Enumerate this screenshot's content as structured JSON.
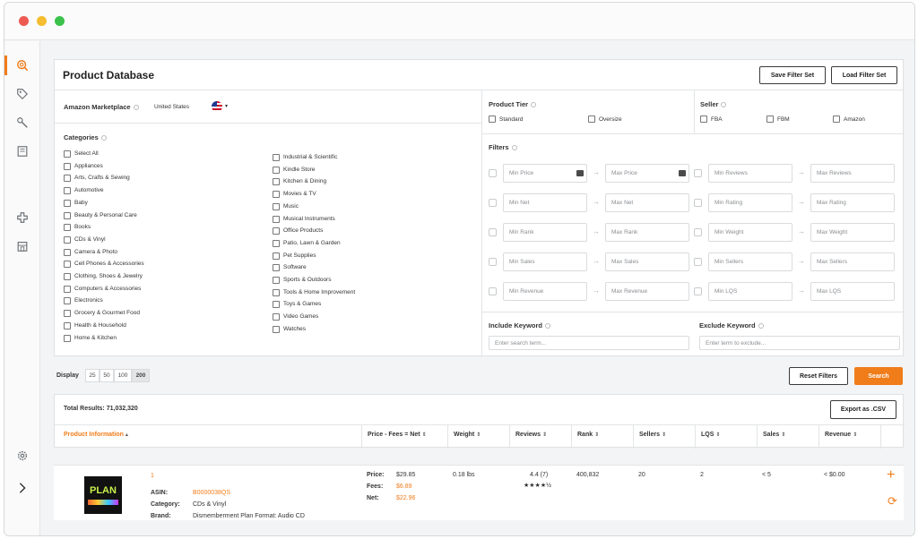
{
  "panel": {
    "title": "Product Database",
    "save_filter_label": "Save Filter Set",
    "load_filter_label": "Load Filter Set"
  },
  "marketplace": {
    "label": "Amazon Marketplace",
    "value": "United States"
  },
  "categories": {
    "label": "Categories",
    "left": [
      "Select All",
      "Appliances",
      "Arts, Crafts & Sewing",
      "Automotive",
      "Baby",
      "Beauty & Personal Care",
      "Books",
      "CDs & Vinyl",
      "Camera & Photo",
      "Cell Phones & Accessories",
      "Clothing, Shoes & Jewelry",
      "Computers & Accessories",
      "Electronics",
      "Grocery & Gourmet Food",
      "Health & Household",
      "Home & Kitchen"
    ],
    "right": [
      "Industrial & Scientific",
      "Kindle Store",
      "Kitchen & Dining",
      "Movies & TV",
      "Music",
      "Musical Instruments",
      "Office Products",
      "Patio, Lawn & Garden",
      "Pet Supplies",
      "Software",
      "Sports & Outdoors",
      "Tools & Home Improvement",
      "Toys & Games",
      "Video Games",
      "Watches"
    ]
  },
  "tier": {
    "label": "Product Tier",
    "standard": "Standard",
    "oversize": "Oversize"
  },
  "seller": {
    "label": "Seller",
    "fba": "FBA",
    "fbm": "FBM",
    "amazon": "Amazon"
  },
  "filters": {
    "label": "Filters",
    "rows": [
      [
        "Min Price",
        "Max Price",
        "Min Reviews",
        "Max Reviews"
      ],
      [
        "Min Net",
        "Max Net",
        "Min Rating",
        "Max Rating"
      ],
      [
        "Min Rank",
        "Max Rank",
        "Min Weight",
        "Max Weight"
      ],
      [
        "Min Sales",
        "Max Sales",
        "Min Sellers",
        "Max Sellers"
      ],
      [
        "Min Revenue",
        "Max Revenue",
        "Min LQS",
        "Max LQS"
      ]
    ]
  },
  "keywords": {
    "include_label": "Include Keyword",
    "include_placeholder": "Enter search term...",
    "exclude_label": "Exclude Keyword",
    "exclude_placeholder": "Enter term to exclude..."
  },
  "display": {
    "label": "Display",
    "options": [
      "25",
      "50",
      "100",
      "200"
    ],
    "selected": "200"
  },
  "actions": {
    "reset_label": "Reset Filters",
    "search_label": "Search"
  },
  "results": {
    "total_label": "Total Results:",
    "total_value": "71,032,320",
    "export_label": "Export as .CSV",
    "columns": [
      "Product Information",
      "Price - Fees = Net",
      "Weight",
      "Reviews",
      "Rank",
      "Sellers",
      "LQS",
      "Sales",
      "Revenue"
    ]
  },
  "product": {
    "index": "1",
    "asin_label": "ASIN:",
    "asin": "B0000038QS",
    "category_label": "Category:",
    "category": "CDs & Vinyl",
    "brand_label": "Brand:",
    "brand": "Dismemberment Plan Format: Audio CD",
    "cover_text": "PLAN",
    "price_label": "Price:",
    "price": "$29.85",
    "fees_label": "Fees:",
    "fees": "$6.89",
    "net_label": "Net:",
    "net": "$22.96",
    "weight": "0.18 lbs",
    "reviews": "4.4 (7)",
    "stars": "★★★★½",
    "rank": "400,832",
    "sellers": "20",
    "lqs": "2",
    "sales": "< 5",
    "revenue": "< $0.00"
  },
  "colors": {
    "accent": "#f07c1a"
  }
}
